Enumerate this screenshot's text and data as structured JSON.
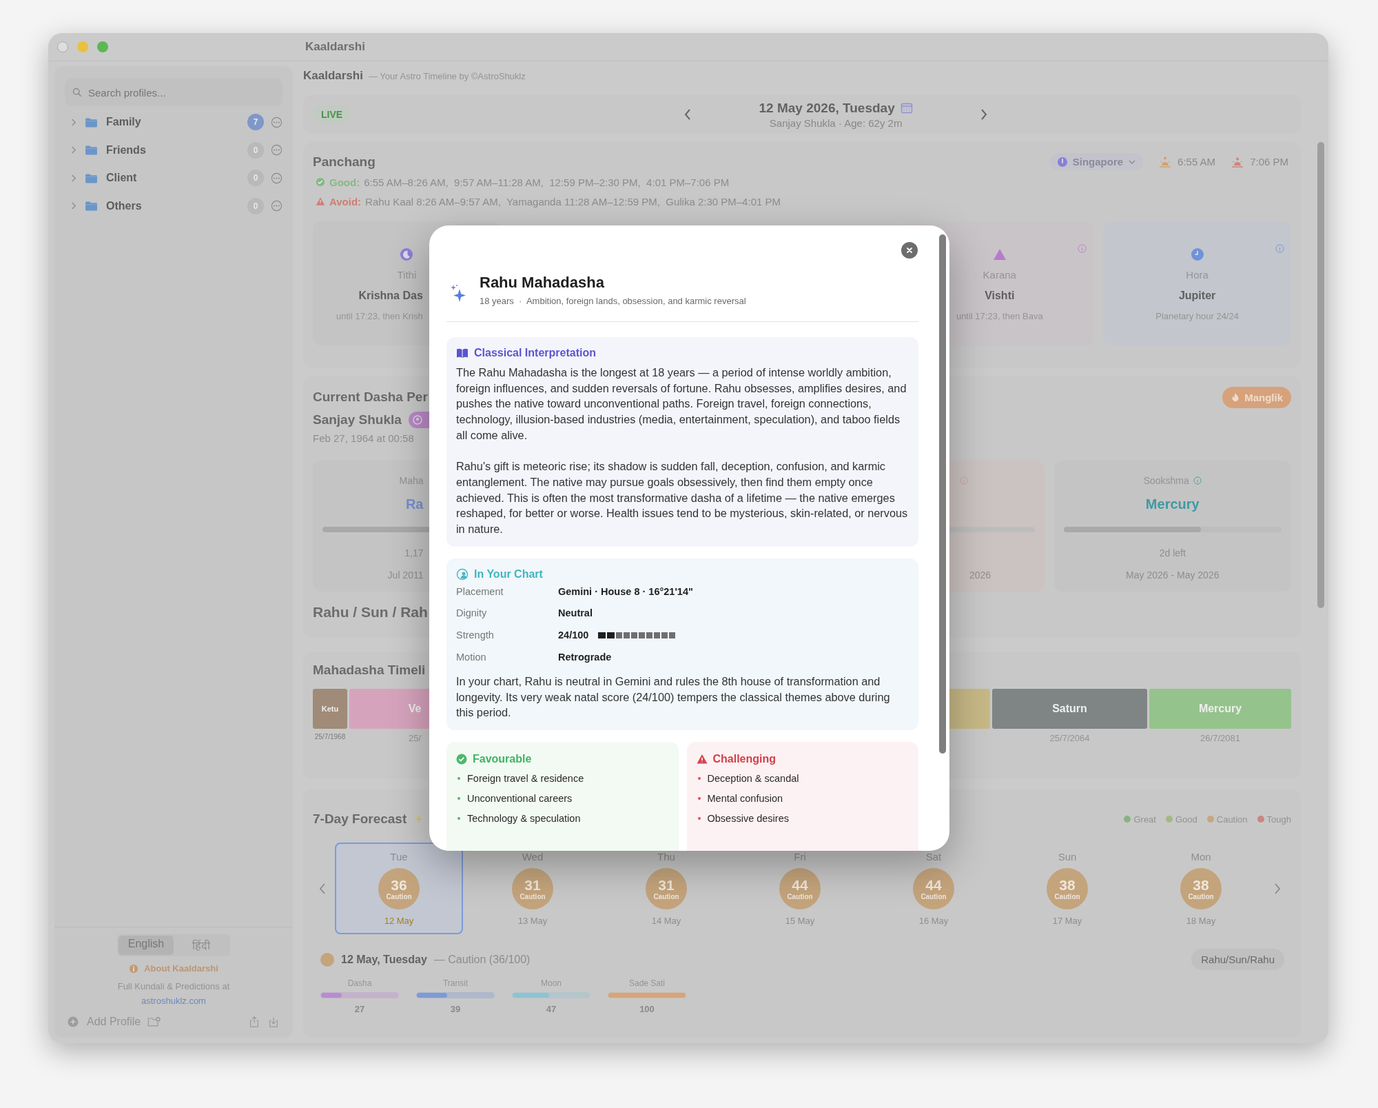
{
  "window": {
    "title": "Kaaldarshi"
  },
  "sidebar": {
    "search": {
      "placeholder": "Search profiles..."
    },
    "groups": [
      {
        "label": "Family",
        "count": "7",
        "color": "#7f97c9"
      },
      {
        "label": "Friends",
        "count": "0",
        "color": "#b9b9b9"
      },
      {
        "label": "Client",
        "count": "0",
        "color": "#b9b9b9"
      },
      {
        "label": "Others",
        "count": "0",
        "color": "#b9b9b9"
      }
    ],
    "language_toggle": [
      {
        "label": "English",
        "selected": true
      },
      {
        "label": "हिंदी",
        "selected": false
      }
    ],
    "about": "About Kaaldarshi",
    "promo": "Full Kundali & Predictions at",
    "link": "astroshuklz.com",
    "add_profile": "Add Profile"
  },
  "header": {
    "app_name": "Kaaldarshi",
    "tagline": "— Your Astro Timeline by ©AstroShuklz"
  },
  "date_bar": {
    "live": "LIVE",
    "date": "12 May 2026, Tuesday",
    "subtitle": "Sanjay Shukla · Age: 62y 2m"
  },
  "panchang": {
    "title": "Panchang",
    "location": "Singapore",
    "sunrise": "6:55 AM",
    "sunset": "7:06 PM",
    "good": {
      "label": "Good:",
      "text": "6:55 AM–8:26 AM,  9:57 AM–11:28 AM,  12:59 PM–2:30 PM,  4:01 PM–7:06 PM"
    },
    "avoid": {
      "label": "Avoid:",
      "text": "Rahu Kaal 8:26 AM–9:57 AM,  Yamaganda 11:28 AM–12:59 PM,  Gulika 2:30 PM–4:01 PM"
    },
    "cards": [
      {
        "kind": "moon",
        "label": "Tithi",
        "value": "Krishna Das",
        "note": "until 17:23, then Krish",
        "color": "#8a7fd6"
      },
      {
        "kind": "triangle",
        "label": "Karana",
        "value": "Vishti",
        "note": "until 17:23, then Bava",
        "color": "#b57ccc"
      },
      {
        "kind": "clock",
        "label": "Hora",
        "value": "Jupiter",
        "note": "Planetary hour 24/24",
        "color": "#6f93d8"
      }
    ]
  },
  "dasha": {
    "title": "Current Dasha Per",
    "manglik": "Manglik",
    "name": "Sanjay Shukla",
    "birth": "Feb 27, 1964 at 00:58",
    "cards": [
      {
        "label": "Maha",
        "planet": "Ra",
        "level": 0.82,
        "remaining": "1,17",
        "range": "Jul 2011",
        "color": "#7390d0"
      },
      {
        "range": "2026"
      },
      {
        "label": "Sookshma",
        "planet": "Mercury",
        "level": 0.63,
        "remaining": "2d left",
        "range": "May 2026 - May 2026",
        "color": "#3f99a2"
      }
    ],
    "path": "Rahu / Sun / Rah"
  },
  "timeline": {
    "title": "Mahadasha Timeli",
    "segments": [
      {
        "label": "Ketu",
        "date": "25/7/1968",
        "color": "#a08b78"
      },
      {
        "label": "Ve",
        "date": "25/",
        "color": "#d6a3bd"
      },
      {
        "color": "#c7b886"
      },
      {
        "label": "Saturn",
        "date": "25/7/2064",
        "color": "#7f8585"
      },
      {
        "label": "Mercury",
        "date": "26/7/2081",
        "color": "#95c38c"
      }
    ]
  },
  "forecast": {
    "title": "7-Day Forecast",
    "legend": [
      {
        "label": "Great",
        "color": "#86b386"
      },
      {
        "label": "Good",
        "color": "#a2b985"
      },
      {
        "label": "Caution",
        "color": "#c9a67c"
      },
      {
        "label": "Tough",
        "color": "#c98780"
      }
    ],
    "days": [
      {
        "day": "Tue",
        "score": "36",
        "rating": "Caution",
        "date": "12 May",
        "selected": true,
        "color": "#c4a47c"
      },
      {
        "day": "Wed",
        "score": "31",
        "rating": "Caution",
        "date": "13 May",
        "selected": false,
        "color": "#c4a47c"
      },
      {
        "day": "Thu",
        "score": "31",
        "rating": "Caution",
        "date": "14 May",
        "selected": false,
        "color": "#c4a47c"
      },
      {
        "day": "Fri",
        "score": "44",
        "rating": "Caution",
        "date": "15 May",
        "selected": false,
        "color": "#c4a47c"
      },
      {
        "day": "Sat",
        "score": "44",
        "rating": "Caution",
        "date": "16 May",
        "selected": false,
        "color": "#c4a47c"
      },
      {
        "day": "Sun",
        "score": "38",
        "rating": "Caution",
        "date": "17 May",
        "selected": false,
        "color": "#c4a47c"
      },
      {
        "day": "Mon",
        "score": "38",
        "rating": "Caution",
        "date": "18 May",
        "selected": false,
        "color": "#c4a47c"
      }
    ],
    "detail": {
      "date": "12 May, Tuesday",
      "summary": "— Caution (36/100)",
      "color": "#c4a47c",
      "path": "Rahu/Sun/Rahu",
      "factors": [
        {
          "label": "Dasha",
          "value": "27",
          "level": 0.27,
          "color": "#b98bd0"
        },
        {
          "label": "Transit",
          "value": "39",
          "level": 0.39,
          "color": "#7d9bd6"
        },
        {
          "label": "Moon",
          "value": "47",
          "level": 0.47,
          "color": "#8ec3d3"
        },
        {
          "label": "Sade Sati",
          "value": "100",
          "level": 1.0,
          "color": "#d6a57c"
        }
      ]
    }
  },
  "modal": {
    "title": "Rahu Mahadasha",
    "subtitle": "18 years  ·  Ambition, foreign lands, obsession, and karmic reversal",
    "classical": {
      "heading": "Classical Interpretation",
      "paragraphs": [
        "The Rahu Mahadasha is the longest at 18 years — a period of intense worldly ambition, foreign influences, and sudden reversals of fortune. Rahu obsesses, amplifies desires, and pushes the native toward unconventional paths. Foreign travel, foreign connections, technology, illusion-based industries (media, entertainment, speculation), and taboo fields all come alive.",
        "Rahu's gift is meteoric rise; its shadow is sudden fall, deception, confusion, and karmic entanglement. The native may pursue goals obsessively, then find them empty once achieved. This is often the most transformative dasha of a lifetime — the native emerges reshaped, for better or worse. Health issues tend to be mysterious, skin-related, or nervous in nature."
      ]
    },
    "chart": {
      "heading": "In Your Chart",
      "rows": [
        {
          "label": "Placement",
          "value": "Gemini · House 8 · 16°21'14\""
        },
        {
          "label": "Dignity",
          "value": "Neutral"
        },
        {
          "label": "Strength",
          "value": "24/100",
          "level": 0.24
        },
        {
          "label": "Motion",
          "value": "Retrograde"
        }
      ],
      "text": "In your chart, Rahu is neutral in Gemini and rules the 8th house of transformation and longevity. Its very weak natal score (24/100) tempers the classical themes above during this period."
    },
    "favourable": {
      "heading": "Favourable",
      "items": [
        "Foreign travel & residence",
        "Unconventional careers",
        "Technology & speculation"
      ]
    },
    "challenging": {
      "heading": "Challenging",
      "items": [
        "Deception & scandal",
        "Mental confusion",
        "Obsessive desires"
      ]
    }
  }
}
